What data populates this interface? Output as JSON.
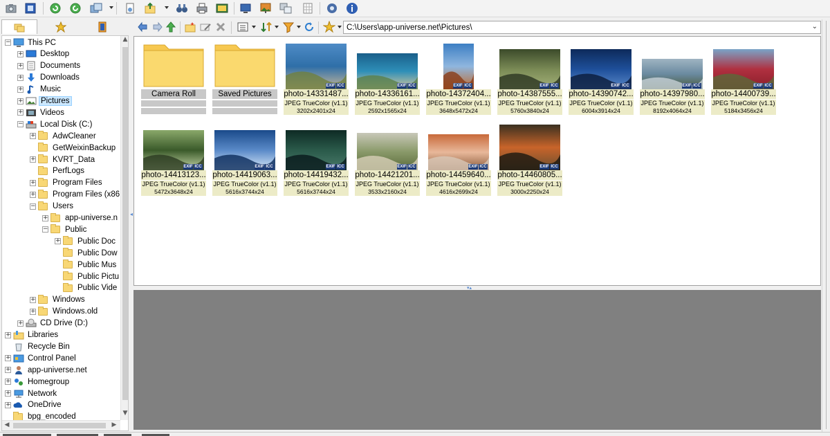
{
  "toolbar": {
    "icons": [
      "camera-icon",
      "fullscreen-icon",
      "rotate-left-icon",
      "rotate-right-icon",
      "convert-icon",
      "open-icon",
      "export-icon",
      "binoculars-icon",
      "print-icon",
      "slideshow-icon",
      "screen-capture-icon",
      "wallpaper-icon",
      "compare-icon",
      "grid-icon",
      "settings-icon",
      "info-icon"
    ]
  },
  "left_tabs": [
    "folders-tab",
    "favorites-tab",
    "categories-tab"
  ],
  "tree": {
    "items": [
      {
        "label": "This PC",
        "level": 0,
        "icon": "pc-icon",
        "exp": "-"
      },
      {
        "label": "Desktop",
        "level": 1,
        "icon": "desktop-icon",
        "exp": "+"
      },
      {
        "label": "Documents",
        "level": 1,
        "icon": "documents-icon",
        "exp": "+"
      },
      {
        "label": "Downloads",
        "level": 1,
        "icon": "downloads-icon",
        "exp": "+"
      },
      {
        "label": "Music",
        "level": 1,
        "icon": "music-icon",
        "exp": "+"
      },
      {
        "label": "Pictures",
        "level": 1,
        "icon": "pictures-icon",
        "exp": "+",
        "selected": true
      },
      {
        "label": "Videos",
        "level": 1,
        "icon": "videos-icon",
        "exp": "+"
      },
      {
        "label": "Local Disk (C:)",
        "level": 1,
        "icon": "disk-icon",
        "exp": "-"
      },
      {
        "label": "AdwCleaner",
        "level": 2,
        "icon": "folder",
        "exp": "+"
      },
      {
        "label": "GetWeixinBackup",
        "level": 2,
        "icon": "folder",
        "exp": ""
      },
      {
        "label": "KVRT_Data",
        "level": 2,
        "icon": "folder",
        "exp": "+"
      },
      {
        "label": "PerfLogs",
        "level": 2,
        "icon": "folder",
        "exp": ""
      },
      {
        "label": "Program Files",
        "level": 2,
        "icon": "folder",
        "exp": "+"
      },
      {
        "label": "Program Files (x86",
        "level": 2,
        "icon": "folder",
        "exp": "+"
      },
      {
        "label": "Users",
        "level": 2,
        "icon": "folder",
        "exp": "-"
      },
      {
        "label": "app-universe.n",
        "level": 3,
        "icon": "folder",
        "exp": "+"
      },
      {
        "label": "Public",
        "level": 3,
        "icon": "folder",
        "exp": "-"
      },
      {
        "label": "Public Doc",
        "level": 4,
        "icon": "folder",
        "exp": "+"
      },
      {
        "label": "Public Dow",
        "level": 4,
        "icon": "folder",
        "exp": ""
      },
      {
        "label": "Public Mus",
        "level": 4,
        "icon": "folder",
        "exp": ""
      },
      {
        "label": "Public Pictu",
        "level": 4,
        "icon": "folder",
        "exp": ""
      },
      {
        "label": "Public Vide",
        "level": 4,
        "icon": "folder",
        "exp": ""
      },
      {
        "label": "Windows",
        "level": 2,
        "icon": "folder",
        "exp": "+"
      },
      {
        "label": "Windows.old",
        "level": 2,
        "icon": "folder",
        "exp": "+"
      },
      {
        "label": "CD Drive (D:)",
        "level": 1,
        "icon": "cd-icon",
        "exp": "+"
      },
      {
        "label": "Libraries",
        "level": 0,
        "icon": "libraries-icon",
        "exp": "+"
      },
      {
        "label": "Recycle Bin",
        "level": 0,
        "icon": "recycle-bin-icon",
        "exp": ""
      },
      {
        "label": "Control Panel",
        "level": 0,
        "icon": "control-panel-icon",
        "exp": "+"
      },
      {
        "label": "app-universe.net",
        "level": 0,
        "icon": "user-icon",
        "exp": "+"
      },
      {
        "label": "Homegroup",
        "level": 0,
        "icon": "homegroup-icon",
        "exp": "+"
      },
      {
        "label": "Network",
        "level": 0,
        "icon": "network-icon",
        "exp": "+"
      },
      {
        "label": "OneDrive",
        "level": 0,
        "icon": "onedrive-icon",
        "exp": "+"
      },
      {
        "label": "bpg_encoded",
        "level": 0,
        "icon": "folder",
        "exp": ""
      }
    ]
  },
  "address": {
    "path": "C:\\Users\\app-universe.net\\Pictures\\"
  },
  "browser": {
    "folders": [
      {
        "label": "Camera Roll"
      },
      {
        "label": "Saved Pictures"
      }
    ],
    "photos": [
      {
        "name": "photo-14331487...",
        "type": "JPEG TrueColor (v1.1)",
        "dims": "3202x2401x24",
        "colors": [
          "#4e8bc6",
          "#2f6fa8",
          "#c9b89a",
          "#6f7f3e"
        ]
      },
      {
        "name": "photo-14336161...",
        "type": "JPEG TrueColor (v1.1)",
        "dims": "2592x1565x24",
        "colors": [
          "#1a5f8a",
          "#2e8fb8",
          "#d9c79a",
          "#5a7f4a"
        ]
      },
      {
        "name": "photo-14372404...",
        "type": "JPEG TrueColor (v1.1)",
        "dims": "3648x5472x24",
        "colors": [
          "#3d7fc4",
          "#8fb6de",
          "#c06a2e",
          "#8a3c18"
        ]
      },
      {
        "name": "photo-14387555...",
        "type": "JPEG TrueColor (v1.1)",
        "dims": "5760x3840x24",
        "colors": [
          "#3b4a2a",
          "#7a8a55",
          "#a5b27a",
          "#2b3520"
        ]
      },
      {
        "name": "photo-14390742...",
        "type": "JPEG TrueColor (v1.1)",
        "dims": "6004x3914x24",
        "colors": [
          "#0d2a5a",
          "#1e4f9a",
          "#5a88c8",
          "#0a1a3a"
        ]
      },
      {
        "name": "photo-14397980...",
        "type": "JPEG TrueColor (v1.1)",
        "dims": "8192x4064x24",
        "colors": [
          "#9fb4c2",
          "#6a8aa0",
          "#4a5a3a",
          "#c8d2d8"
        ]
      },
      {
        "name": "photo-14400739...",
        "type": "JPEG TrueColor (v1.1)",
        "dims": "5184x3456x24",
        "colors": [
          "#7aa4c8",
          "#b03040",
          "#8a1e2a",
          "#5a6a3a"
        ]
      },
      {
        "name": "photo-14413123...",
        "type": "JPEG TrueColor (v1.1)",
        "dims": "5472x3648x24",
        "colors": [
          "#8aa86a",
          "#3a5a2a",
          "#c8d8a8",
          "#2a3a20"
        ]
      },
      {
        "name": "photo-14419063...",
        "type": "JPEG TrueColor (v1.1)",
        "dims": "5616x3744x24",
        "colors": [
          "#1a4a8a",
          "#5a8ac8",
          "#d8e8f8",
          "#0a2a5a"
        ]
      },
      {
        "name": "photo-14419432...",
        "type": "JPEG TrueColor (v1.1)",
        "dims": "5616x3744x24",
        "colors": [
          "#0e2a24",
          "#2a5a4a",
          "#4a7a6a",
          "#08181a"
        ]
      },
      {
        "name": "photo-14421201...",
        "type": "JPEG TrueColor (v1.1)",
        "dims": "3533x2160x24",
        "colors": [
          "#c8c8b8",
          "#8a9a6a",
          "#5a6a3a",
          "#d8d0b8"
        ]
      },
      {
        "name": "photo-14459640...",
        "type": "JPEG TrueColor (v1.1)",
        "dims": "4616x2699x24",
        "colors": [
          "#c86a3a",
          "#e8b89a",
          "#8a5a3a",
          "#d8c8b8"
        ]
      },
      {
        "name": "photo-14460805...",
        "type": "JPEG TrueColor (v1.1)",
        "dims": "3000x2250x24",
        "colors": [
          "#3a3020",
          "#c8642a",
          "#6a5030",
          "#1a1810"
        ]
      }
    ],
    "badges": [
      "EXIF",
      "ICC"
    ]
  }
}
